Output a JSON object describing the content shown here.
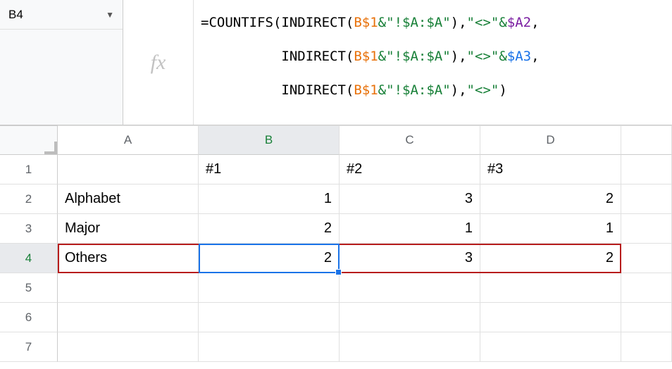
{
  "nameBox": {
    "value": "B4"
  },
  "fx": {
    "label": "fx"
  },
  "formula": {
    "line1": {
      "pre": "=COUNTIFS(INDIRECT(",
      "b1": "B$1",
      "amp1": "&",
      "str1": "\"!$A:$A\"",
      "comma1": ")",
      "sep1": ",",
      "str2": "\"<>\"",
      "amp2": "&",
      "a2": "$A2",
      "tail": ","
    },
    "line2": {
      "pre": "          INDIRECT(",
      "b1": "B$1",
      "amp1": "&",
      "str1": "\"!$A:$A\"",
      "comma1": ")",
      "sep1": ",",
      "str2": "\"<>\"",
      "amp2": "&",
      "a3": "$A3",
      "tail": ","
    },
    "line3": {
      "pre": "          INDIRECT(",
      "b1": "B$1",
      "amp1": "&",
      "str1": "\"!$A:$A\"",
      "comma1": ")",
      "sep1": ",",
      "str2": "\"<>\"",
      "tail": ")"
    }
  },
  "columns": [
    "A",
    "B",
    "C",
    "D"
  ],
  "rowLabels": [
    "1",
    "2",
    "3",
    "4",
    "5",
    "6",
    "7"
  ],
  "cells": {
    "B1": "#1",
    "C1": "#2",
    "D1": "#3",
    "A2": "Alphabet",
    "B2": "1",
    "C2": "3",
    "D2": "2",
    "A3": "Major",
    "B3": "2",
    "C3": "1",
    "D3": "1",
    "A4": "Others",
    "B4": "2",
    "C4": "3",
    "D4": "2"
  }
}
